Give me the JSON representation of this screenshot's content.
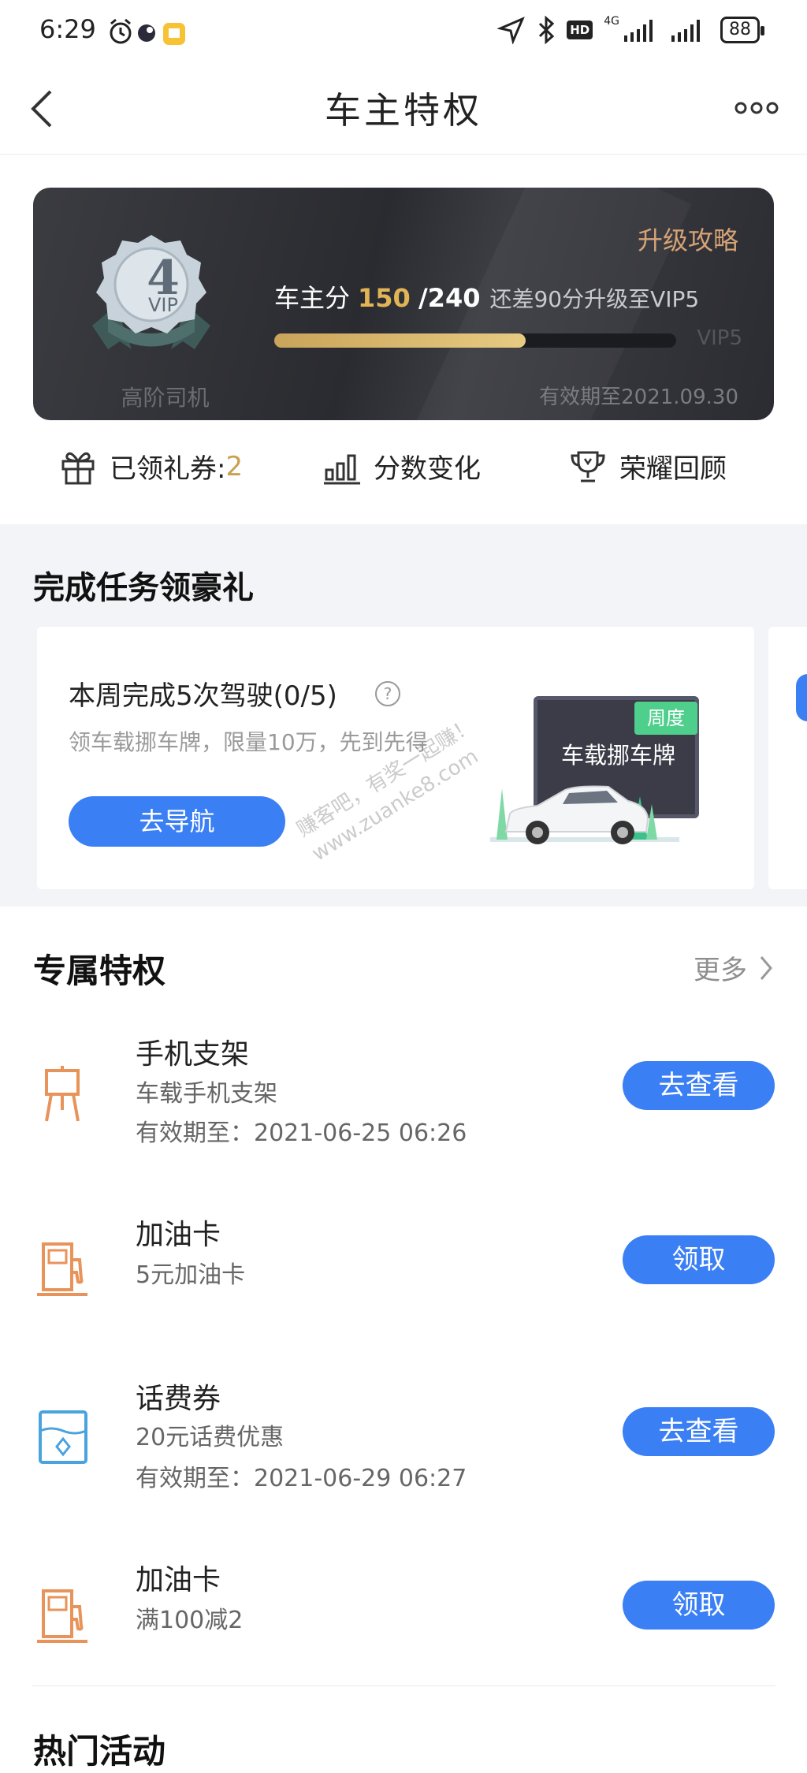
{
  "status_bar": {
    "time": "6:29",
    "network": "4G",
    "hd": "HD",
    "battery": "88"
  },
  "header": {
    "title": "车主特权"
  },
  "vip_card": {
    "level_number": "4",
    "level_vip": "VIP",
    "level_name": "高阶司机",
    "upgrade_link": "升级攻略",
    "score_label": "车主分",
    "score_current": "150",
    "score_total": "/240",
    "score_hint": "还差90分升级至VIP5",
    "progress_fraction": 0.625,
    "next_level": "VIP5",
    "valid_until": "有效期至2021.09.30"
  },
  "quick_links": {
    "coupons_label": "已领礼券: ",
    "coupons_count": "2",
    "score_change": "分数变化",
    "honor_review": "荣耀回顾"
  },
  "tasks": {
    "section_title": "完成任务领豪礼",
    "card": {
      "title": "本周完成5次驾驶(0/5)",
      "subtitle": "领车载挪车牌，限量10万，先到先得",
      "button": "去导航",
      "tag": "周度",
      "prize": "车载挪车牌"
    }
  },
  "privileges": {
    "section_title": "专属特权",
    "more_label": "更多",
    "items": [
      {
        "name": "手机支架",
        "desc": "车载手机支架",
        "valid": "有效期至：2021-06-25 06:26",
        "button": "去查看",
        "icon": "phone-stand-icon"
      },
      {
        "name": "加油卡",
        "desc": "5元加油卡",
        "valid": "",
        "button": "领取",
        "icon": "fuel-pump-icon"
      },
      {
        "name": "话费券",
        "desc": "20元话费优惠",
        "valid": "有效期至：2021-06-29 06:27",
        "button": "去查看",
        "icon": "phone-bill-icon"
      },
      {
        "name": "加油卡",
        "desc": "满100减2",
        "valid": "",
        "button": "领取",
        "icon": "fuel-pump-icon"
      }
    ]
  },
  "hot_section": {
    "title": "热门活动"
  },
  "watermark": {
    "line1": "赚客吧，有奖一起赚！",
    "line2": "www.zuanke8.com"
  },
  "colors": {
    "accent_blue": "#3b7ff5",
    "gold": "#e1b455",
    "icon_orange": "#e8935a",
    "icon_blue": "#4aa3df"
  }
}
